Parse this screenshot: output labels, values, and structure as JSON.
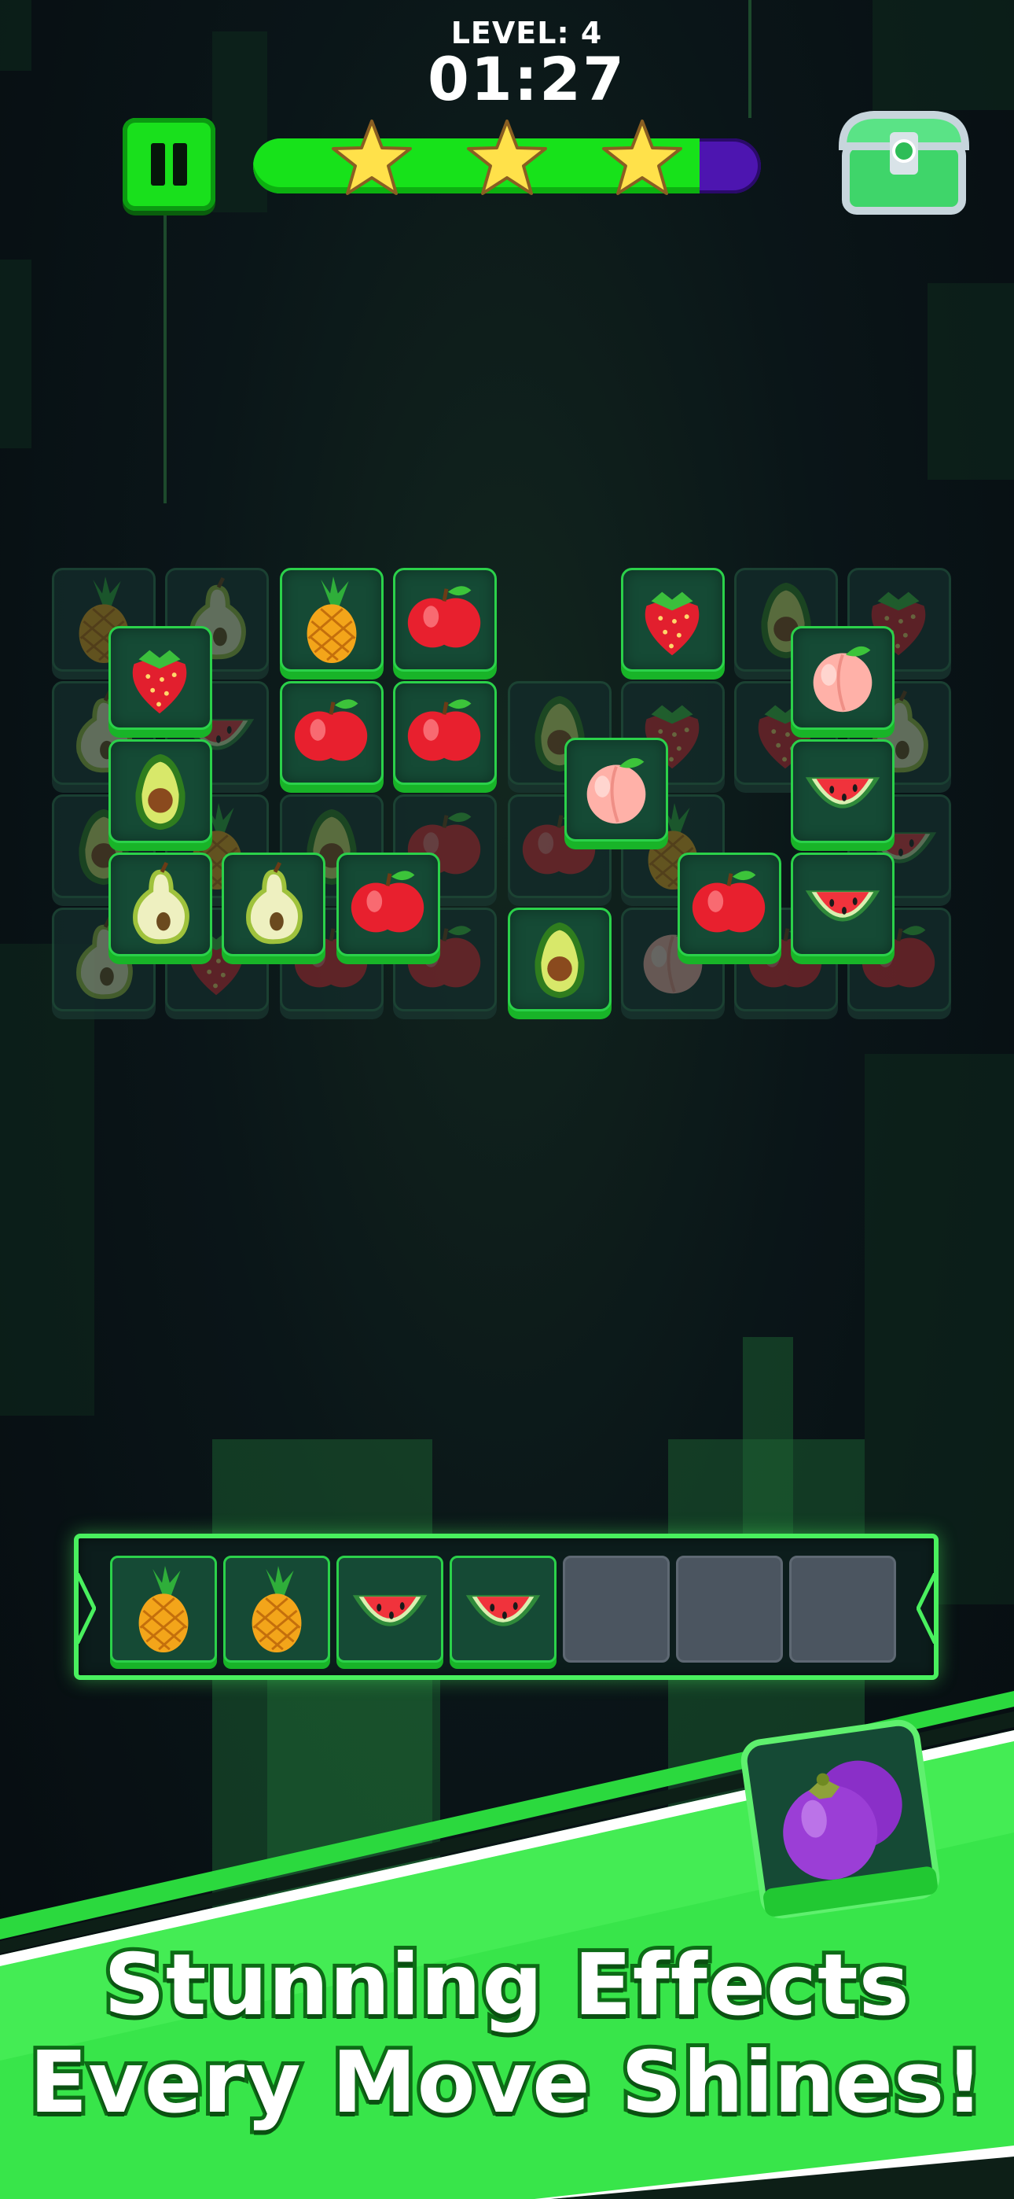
{
  "hud": {
    "level_text": "LEVEL: 4",
    "timer": "01:27",
    "progress_fraction": 0.88,
    "stars_earned": 3,
    "pause_label": "pause",
    "chest_label": "reward chest"
  },
  "colors": {
    "accent_green": "#19e01c",
    "tile_border": "#2bd14a",
    "progress_empty": "#4d15b0",
    "banner_green": "#3de84c",
    "star_yellow": "#ffe14a"
  },
  "board": {
    "tiles": [
      {
        "fruit": "pineapple",
        "state": "covered"
      },
      {
        "fruit": "pear",
        "state": "covered"
      },
      {
        "fruit": "pineapple",
        "state": "open"
      },
      {
        "fruit": "apple",
        "state": "open"
      },
      {
        "fruit": "strawberry",
        "state": "open"
      },
      {
        "fruit": "avocado",
        "state": "covered"
      },
      {
        "fruit": "strawberry",
        "state": "covered"
      },
      {
        "fruit": "strawberry",
        "state": "open"
      },
      {
        "fruit": "peach",
        "state": "open"
      },
      {
        "fruit": "pear",
        "state": "covered"
      },
      {
        "fruit": "watermelon",
        "state": "covered"
      },
      {
        "fruit": "apple",
        "state": "open"
      },
      {
        "fruit": "apple",
        "state": "open"
      },
      {
        "fruit": "avocado",
        "state": "covered"
      },
      {
        "fruit": "strawberry",
        "state": "covered"
      },
      {
        "fruit": "strawberry",
        "state": "covered"
      },
      {
        "fruit": "pear",
        "state": "covered"
      },
      {
        "fruit": "avocado",
        "state": "open"
      },
      {
        "fruit": "peach",
        "state": "open"
      },
      {
        "fruit": "watermelon",
        "state": "open"
      },
      {
        "fruit": "avocado",
        "state": "covered"
      },
      {
        "fruit": "pineapple",
        "state": "covered"
      },
      {
        "fruit": "avocado",
        "state": "covered"
      },
      {
        "fruit": "apple",
        "state": "covered"
      },
      {
        "fruit": "apple",
        "state": "covered"
      },
      {
        "fruit": "pineapple",
        "state": "covered"
      },
      {
        "fruit": "watermelon",
        "state": "covered"
      },
      {
        "fruit": "pear",
        "state": "open"
      },
      {
        "fruit": "pear",
        "state": "open"
      },
      {
        "fruit": "apple",
        "state": "open"
      },
      {
        "fruit": "apple",
        "state": "open"
      },
      {
        "fruit": "watermelon",
        "state": "open"
      },
      {
        "fruit": "pear",
        "state": "covered"
      },
      {
        "fruit": "strawberry",
        "state": "covered"
      },
      {
        "fruit": "apple",
        "state": "covered"
      },
      {
        "fruit": "apple",
        "state": "covered"
      },
      {
        "fruit": "avocado",
        "state": "open"
      },
      {
        "fruit": "peach",
        "state": "covered"
      },
      {
        "fruit": "apple",
        "state": "covered"
      },
      {
        "fruit": "apple",
        "state": "covered"
      }
    ]
  },
  "tray": {
    "slots": [
      "pineapple",
      "pineapple",
      "watermelon",
      "watermelon",
      "",
      "",
      ""
    ]
  },
  "featured_fruit": "mangosteen",
  "banner": {
    "line1": "Stunning Effects",
    "line2": "Every Move Shines!"
  }
}
